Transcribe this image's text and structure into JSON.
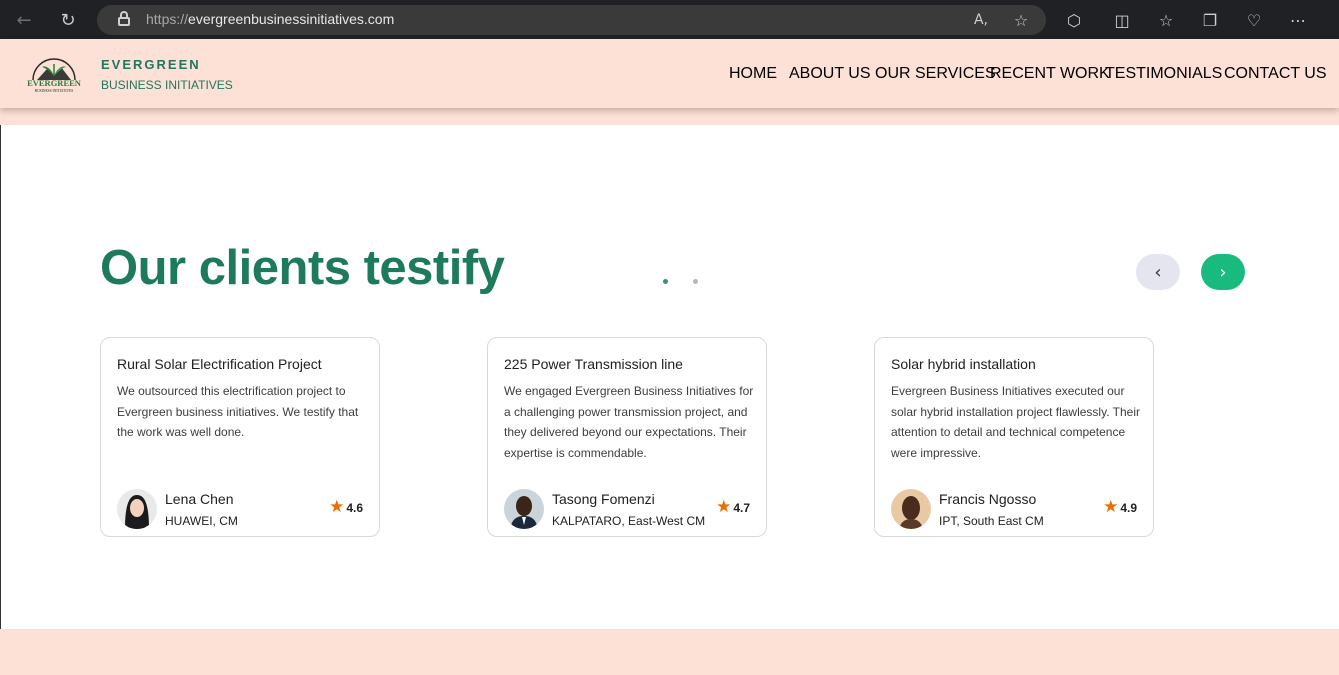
{
  "browser": {
    "url_scheme": "https://",
    "url_host": "evergreenbusinessinitiatives.com",
    "icons": [
      "back-icon",
      "reload-icon",
      "lock-icon",
      "read-aloud-icon",
      "favorite-star-icon",
      "extensions-icon",
      "split-screen-icon",
      "favorites-icon",
      "collections-icon",
      "browser-essentials-icon",
      "more-icon"
    ]
  },
  "header": {
    "brand_name": "EVERGREEN",
    "brand_sub": "BUSINESS INITIATIVES",
    "logo_text": "EVERGREEN",
    "logo_subtext": "BUSINESS INITIATIVES",
    "nav": [
      "HOME",
      "ABOUT US",
      "OUR SERVICES",
      "RECENT WORK",
      "TESTIMONIALS",
      "CONTACT US"
    ]
  },
  "section": {
    "title": "Our clients testify",
    "prev_icon": "‹",
    "next_icon": "›"
  },
  "cards": [
    {
      "title": "Rural Solar Electrification Project",
      "text": "We outsourced this electrification project to Evergreen business initiatives. We testify that the work was well done.",
      "name": "Lena Chen",
      "org": "HUAWEI, CM",
      "rating": "4.6"
    },
    {
      "title": "225 Power Transmission line",
      "text": "We engaged Evergreen Business Initiatives for a challenging power transmission project, and they delivered beyond our expectations. Their expertise is commendable.",
      "name": "Tasong Fomenzi",
      "org": "KALPATARO, East-West CM",
      "rating": "4.7"
    },
    {
      "title": "Solar hybrid installation",
      "text": "Evergreen Business Initiatives executed our solar hybrid installation project flawlessly. Their attention to detail and technical competence were impressive.",
      "name": "Francis Ngosso",
      "org": "IPT, South East CM",
      "rating": "4.9"
    }
  ],
  "colors": {
    "brand_green": "#1e7a5c",
    "header_bg": "#fde0d6",
    "next_button": "#18ba7d",
    "star": "#ef6c00"
  }
}
